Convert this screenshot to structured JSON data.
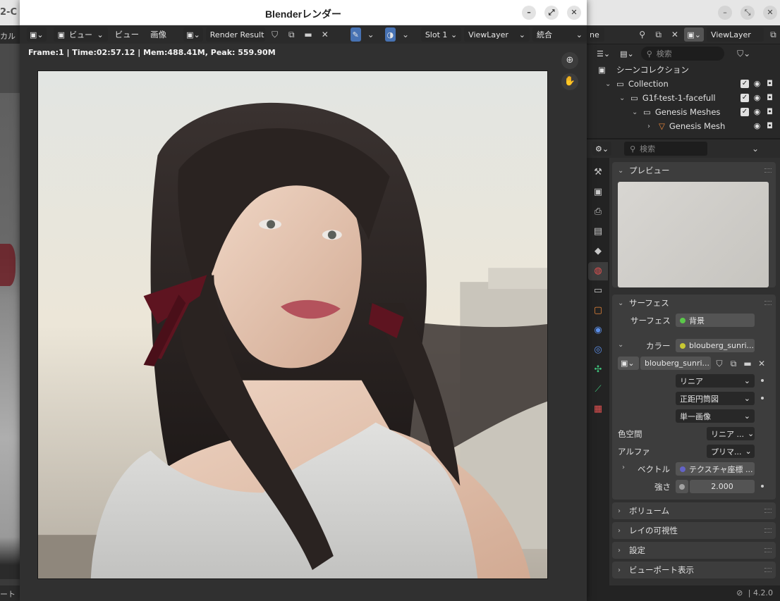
{
  "background_window": {
    "title_fragment": "2-C",
    "left_header_text": "カルフ",
    "left_bottom_text": "ート",
    "controls": [
      "minimize",
      "restore",
      "close"
    ]
  },
  "render_window": {
    "title": "Blenderレンダー",
    "toolbar": {
      "view_menu": "ビュー",
      "view_label": "ビュー",
      "image_menu": "画像",
      "image_name": "Render Result",
      "slot": "Slot 1",
      "view_layer": "ViewLayer",
      "pass": "統合"
    },
    "info": "Frame:1 | Time:02:57.12 | Mem:488.41M, Peak: 559.90M"
  },
  "right_header": {
    "scene_fragment": "ne",
    "view_layer": "ViewLayer"
  },
  "outliner": {
    "search_placeholder": "検索",
    "rows": [
      {
        "label": "シーンコレクション",
        "indent": 0
      },
      {
        "label": "Collection",
        "indent": 1
      },
      {
        "label": "G1f-test-1-facefull",
        "indent": 2
      },
      {
        "label": "Genesis Meshes",
        "indent": 3
      },
      {
        "label": "Genesis Mesh",
        "indent": 4
      }
    ]
  },
  "properties": {
    "search_placeholder": "検索",
    "preview_title": "プレビュー",
    "surface_title": "サーフェス",
    "surface_label": "サーフェス",
    "surface_value": "背景",
    "color_label": "カラー",
    "color_value": "blouberg_sunri...",
    "image_name": "blouberg_sunri...",
    "interpolation": "リニア",
    "projection": "正距円筒図",
    "source": "単一画像",
    "colorspace_label": "色空間",
    "colorspace_value": "リニア ...",
    "alpha_label": "アルファ",
    "alpha_value": "プリマ...",
    "vector_label": "ベクトル",
    "vector_value": "テクスチャ座標 ...",
    "strength_label": "強さ",
    "strength_value": "2.000",
    "volume_title": "ボリューム",
    "ray_visibility_title": "レイの可視性",
    "settings_title": "設定",
    "viewport_display_title": "ビューポート表示"
  },
  "status": {
    "version": "4.2.0"
  },
  "colors": {
    "socket_green": "#5bc84a",
    "socket_yellow": "#c8c832",
    "socket_blue": "#6363c7",
    "socket_gray": "#a1a1a1",
    "ribbon": "#5e1420"
  }
}
